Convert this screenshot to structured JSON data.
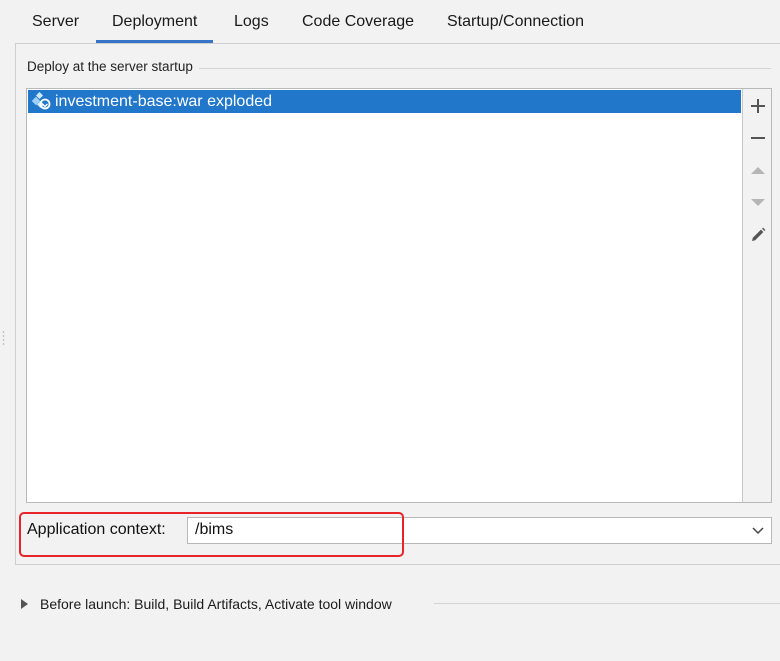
{
  "tabs": [
    {
      "label": "Server",
      "active": false
    },
    {
      "label": "Deployment",
      "active": true
    },
    {
      "label": "Logs",
      "active": false
    },
    {
      "label": "Code Coverage",
      "active": false
    },
    {
      "label": "Startup/Connection",
      "active": false
    }
  ],
  "deploy": {
    "section_title": "Deploy at the server startup",
    "items": [
      {
        "label": "investment-base:war exploded",
        "icon": "artifact-icon",
        "selected": true
      }
    ],
    "toolbar": [
      {
        "icon": "add-icon",
        "enabled": true
      },
      {
        "icon": "remove-icon",
        "enabled": true
      },
      {
        "icon": "move-up-icon",
        "enabled": false
      },
      {
        "icon": "move-down-icon",
        "enabled": false
      },
      {
        "icon": "edit-icon",
        "enabled": true
      }
    ]
  },
  "app_context": {
    "label": "Application context:",
    "value": "/bims"
  },
  "before_launch": {
    "label": "Before launch: Build, Build Artifacts, Activate tool window",
    "expanded": false
  },
  "colors": {
    "accent": "#3574c7",
    "selection": "#2177c9",
    "annotation": "#e8232a",
    "background": "#f2f2f2"
  }
}
